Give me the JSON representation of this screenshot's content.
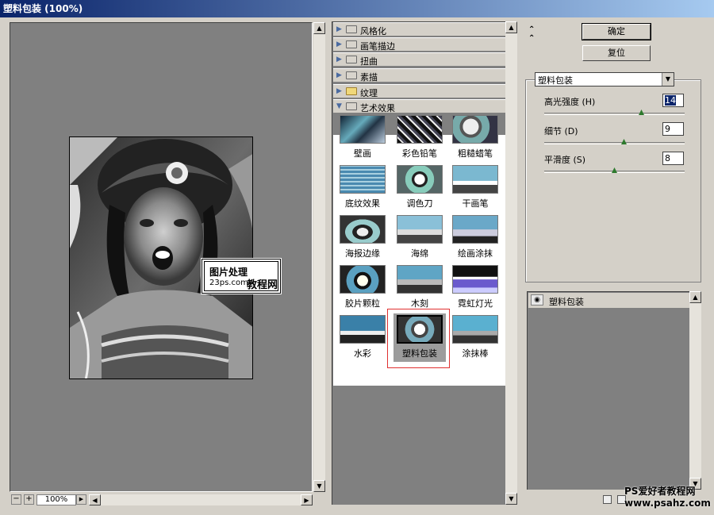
{
  "window": {
    "title": "塑料包装  (100%)"
  },
  "preview": {
    "zoom": "100%",
    "watermark": {
      "line1": "图片处理",
      "line2": "23ps.com",
      "line3": "教程网"
    }
  },
  "gallery": {
    "categories": [
      {
        "label": "风格化",
        "expanded": false
      },
      {
        "label": "画笔描边",
        "expanded": false
      },
      {
        "label": "扭曲",
        "expanded": false
      },
      {
        "label": "素描",
        "expanded": false
      },
      {
        "label": "纹理",
        "expanded": false
      },
      {
        "label": "艺术效果",
        "expanded": true
      }
    ],
    "filters": [
      {
        "label": "壁画"
      },
      {
        "label": "彩色铅笔"
      },
      {
        "label": "粗糙蜡笔"
      },
      {
        "label": "底纹效果"
      },
      {
        "label": "调色刀"
      },
      {
        "label": "干画笔"
      },
      {
        "label": "海报边缘"
      },
      {
        "label": "海绵"
      },
      {
        "label": "绘画涂抹"
      },
      {
        "label": "胶片颗粒"
      },
      {
        "label": "木刻"
      },
      {
        "label": "霓虹灯光"
      },
      {
        "label": "水彩"
      },
      {
        "label": "塑料包装",
        "selected": true
      },
      {
        "label": "涂抹棒"
      }
    ]
  },
  "panel": {
    "collapse_icon": "double-chevron-up-icon",
    "ok_label": "确定",
    "reset_label": "复位",
    "filter_select": "塑料包装",
    "params": [
      {
        "label": "高光强度 (H)",
        "value": "14",
        "level": 0.7
      },
      {
        "label": "细节 (D)",
        "value": "9",
        "level": 0.57
      },
      {
        "label": "平滑度 (S)",
        "value": "8",
        "level": 0.5
      }
    ]
  },
  "layers": {
    "items": [
      {
        "name": "塑料包装",
        "visible": true
      }
    ]
  },
  "footer": {
    "line1": "PS爱好者教程网",
    "line2": "www.psahz.com"
  },
  "colors": {
    "title_start": "#0a246a",
    "title_end": "#a6caf0",
    "selection_frame": "#e03030",
    "panel_bg": "#d4d0c8",
    "canvas_bg": "#808080"
  }
}
